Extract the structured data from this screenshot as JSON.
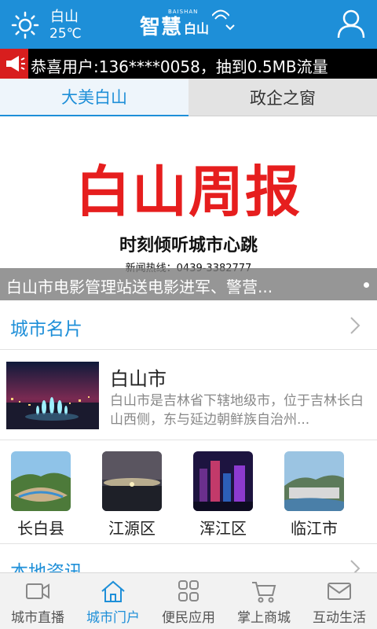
{
  "header": {
    "city": "白山",
    "temperature": "25℃",
    "logo_main": "智慧",
    "logo_sub": "白山",
    "logo_en": "BAISHAN"
  },
  "ticker": {
    "text": "恭喜用户:136****0058，抽到0.5MB流量"
  },
  "tabs": [
    {
      "label": "大美白山",
      "active": true
    },
    {
      "label": "政企之窗",
      "active": false
    }
  ],
  "banner": {
    "title": "白山周报",
    "slogan": "时刻倾听城市心跳",
    "hotline": "新闻热线：0439-3382777",
    "caption": "白山市电影管理站送电影进军、警营..."
  },
  "city_card": {
    "section_title": "城市名片",
    "feature": {
      "title": "白山市",
      "description": "白山市是吉林省下辖地级市，位于吉林长白山西侧，东与延边朝鲜族自治州..."
    },
    "districts": [
      {
        "label": "长白县"
      },
      {
        "label": "江源区"
      },
      {
        "label": "浑江区"
      },
      {
        "label": "临江市"
      }
    ]
  },
  "local_news": {
    "section_title": "本地资讯"
  },
  "bottom_nav": [
    {
      "label": "城市直播",
      "icon": "video-camera-icon",
      "active": false
    },
    {
      "label": "城市门户",
      "icon": "home-icon",
      "active": true
    },
    {
      "label": "便民应用",
      "icon": "apps-grid-icon",
      "active": false
    },
    {
      "label": "掌上商城",
      "icon": "cart-icon",
      "active": false
    },
    {
      "label": "互动生活",
      "icon": "mail-icon",
      "active": false
    }
  ],
  "colors": {
    "brand_blue": "#1e8fd8",
    "banner_red": "#e61e1e",
    "ticker_badge_red": "#d81e1e"
  }
}
